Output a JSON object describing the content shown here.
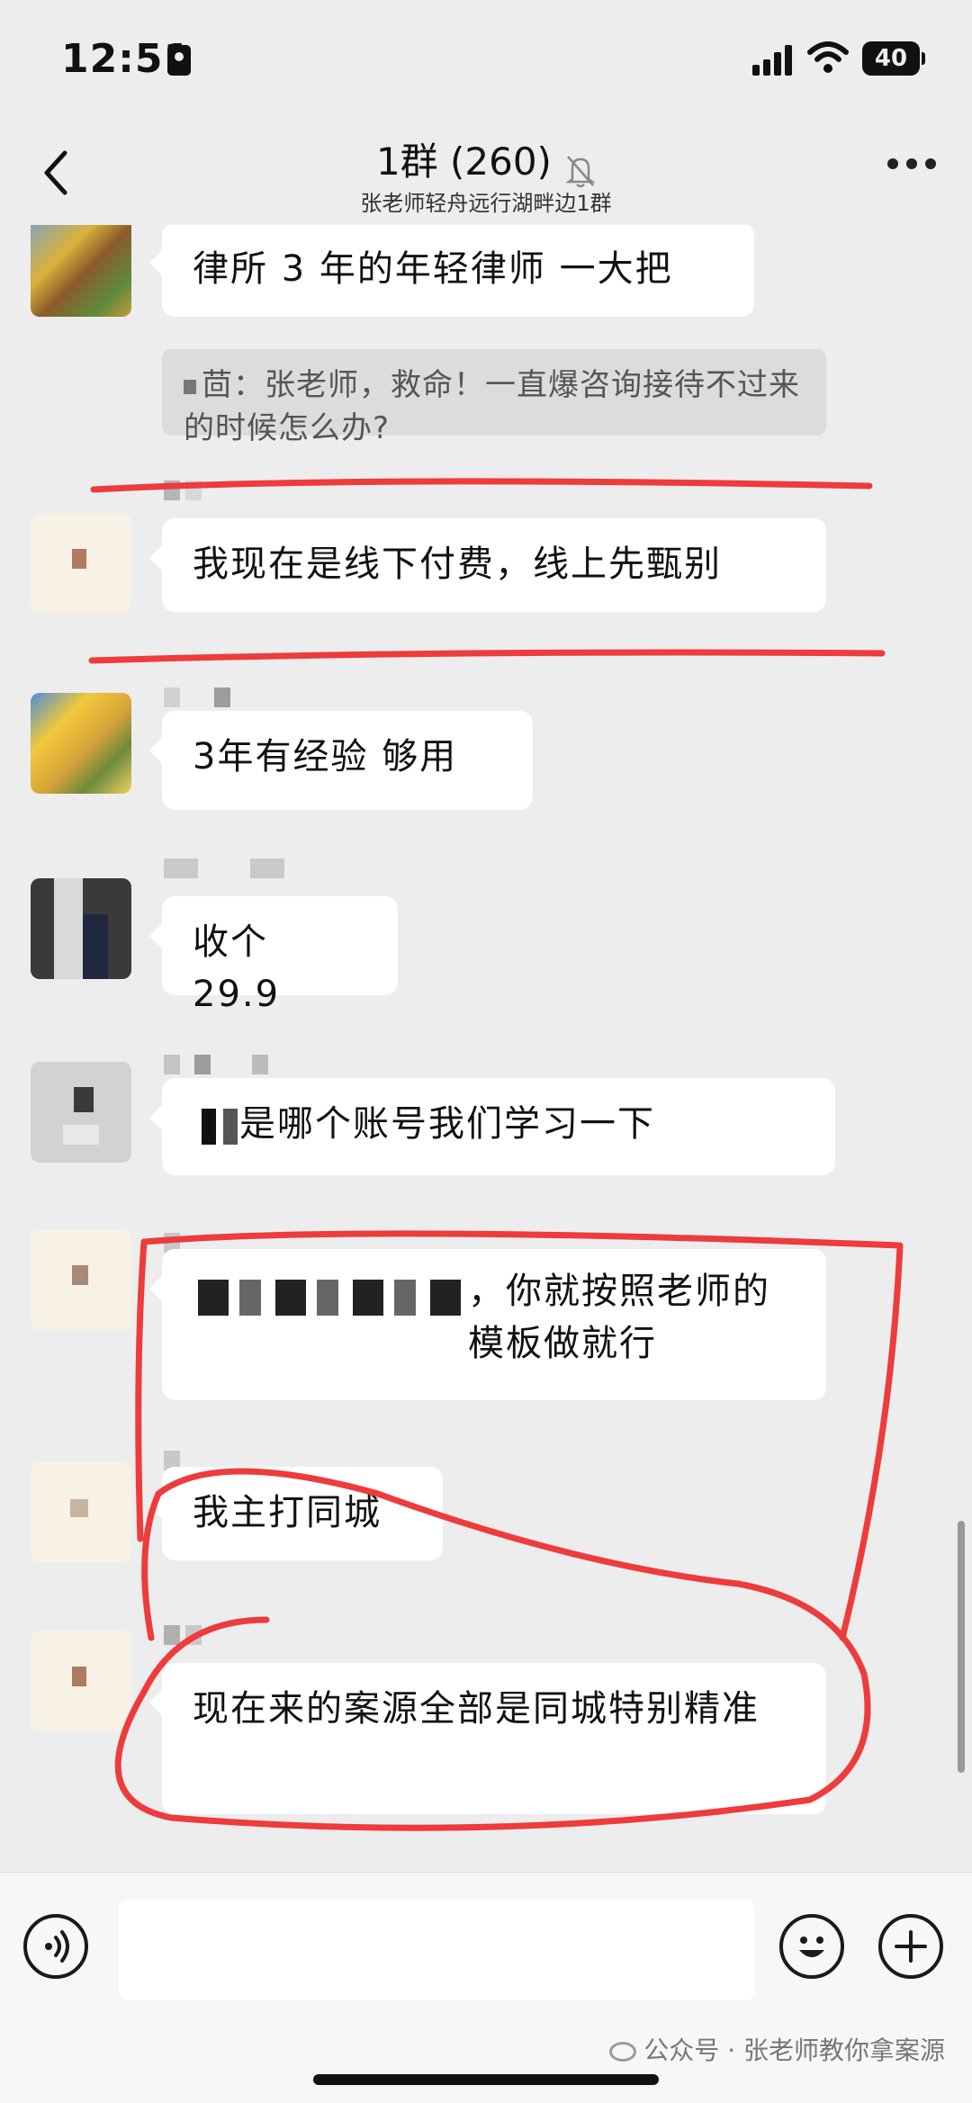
{
  "status_bar": {
    "time": "12:51",
    "battery": "40"
  },
  "header": {
    "title": "1群 (260)",
    "subtitle": "张老师轻舟远行湖畔边1群"
  },
  "messages": [
    {
      "text": "律所 3 年的年轻律师 一大把",
      "quote": "茴：张老师，救命！一直爆咨询接待不过来的时候怎么办?"
    },
    {
      "text": "我现在是线下付费，线上先甄别"
    },
    {
      "text": "3年有经验 够用"
    },
    {
      "text": "收个 29.9"
    },
    {
      "text": "是哪个账号我们学习一下"
    },
    {
      "text": "，你就按照老师的模板做就行"
    },
    {
      "text": "我主打同城"
    },
    {
      "text": "现在来的案源全部是同城特别精准"
    }
  ],
  "watermark": "公众号 · 张老师教你拿案源",
  "colors": {
    "annotation": "#ee3b3b",
    "background": "#ededed",
    "bubble": "#ffffff"
  }
}
